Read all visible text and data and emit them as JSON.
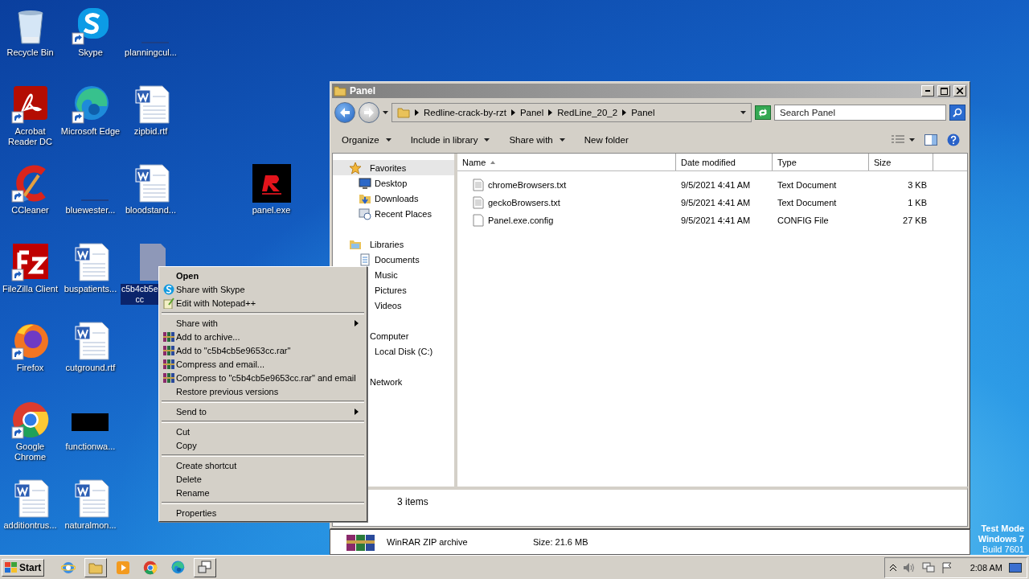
{
  "desktop": {
    "columns": [
      [
        {
          "label": "Recycle Bin",
          "kind": "recycle",
          "shortcut": false,
          "selected": false
        },
        {
          "label": "Acrobat\nReader DC",
          "kind": "acrobat",
          "shortcut": true,
          "selected": false
        },
        {
          "label": "CCleaner",
          "kind": "ccleaner",
          "shortcut": true,
          "selected": false
        },
        {
          "label": "FileZilla Client",
          "kind": "filezilla",
          "shortcut": true,
          "selected": false
        },
        {
          "label": "Firefox",
          "kind": "firefox",
          "shortcut": true,
          "selected": false
        },
        {
          "label": "Google\nChrome",
          "kind": "chrome",
          "shortcut": true,
          "selected": false
        },
        {
          "label": "additiontrus...",
          "kind": "word",
          "shortcut": false,
          "selected": false
        }
      ],
      [
        {
          "label": "Skype",
          "kind": "skype",
          "shortcut": true,
          "selected": false
        },
        {
          "label": "Microsoft Edge",
          "kind": "edge",
          "shortcut": true,
          "selected": false
        },
        {
          "label": "bluewester...",
          "kind": "blank",
          "shortcut": false,
          "selected": false
        },
        {
          "label": "buspatients...",
          "kind": "word",
          "shortcut": false,
          "selected": false
        },
        {
          "label": "cutground.rtf",
          "kind": "word",
          "shortcut": false,
          "selected": false
        },
        {
          "label": "functionwa...",
          "kind": "black",
          "shortcut": false,
          "selected": false
        },
        {
          "label": "naturalmon...",
          "kind": "word",
          "shortcut": false,
          "selected": false
        }
      ],
      [
        {
          "label": "planningcul...",
          "kind": "blank",
          "shortcut": false,
          "selected": false
        },
        {
          "label": "zipbid.rtf",
          "kind": "word",
          "shortcut": false,
          "selected": false
        },
        {
          "label": "bloodstand...",
          "kind": "word",
          "shortcut": false,
          "selected": false
        },
        {
          "label": "c5b4cb5e\ncc",
          "kind": "generic",
          "shortcut": false,
          "selected": true
        }
      ]
    ],
    "free_icon": {
      "label": "panel.exe",
      "kind": "redline",
      "selected": false
    }
  },
  "context_menu": [
    {
      "kind": "plain",
      "label": "Open",
      "default": true
    },
    {
      "kind": "skype",
      "label": "Share with Skype",
      "default": false
    },
    {
      "kind": "notepad",
      "label": "Edit with Notepad++",
      "default": false
    },
    {
      "kind": "separator"
    },
    {
      "kind": "submenu",
      "label": "Share with",
      "default": false
    },
    {
      "kind": "archive",
      "label": "Add to archive...",
      "default": false
    },
    {
      "kind": "archive",
      "label": "Add to \"c5b4cb5e9653cc.rar\"",
      "default": false
    },
    {
      "kind": "archive",
      "label": "Compress and email...",
      "default": false
    },
    {
      "kind": "archive",
      "label": "Compress to \"c5b4cb5e9653cc.rar\" and email",
      "default": false
    },
    {
      "kind": "plain",
      "label": "Restore previous versions",
      "default": false
    },
    {
      "kind": "separator"
    },
    {
      "kind": "submenu",
      "label": "Send to",
      "default": false
    },
    {
      "kind": "separator"
    },
    {
      "kind": "plain",
      "label": "Cut",
      "default": false
    },
    {
      "kind": "plain",
      "label": "Copy",
      "default": false
    },
    {
      "kind": "separator"
    },
    {
      "kind": "plain",
      "label": "Create shortcut",
      "default": false
    },
    {
      "kind": "plain",
      "label": "Delete",
      "default": false
    },
    {
      "kind": "plain",
      "label": "Rename",
      "default": false
    },
    {
      "kind": "separator"
    },
    {
      "kind": "plain",
      "label": "Properties",
      "default": false
    }
  ],
  "explorer": {
    "title": "Panel",
    "breadcrumb": [
      "Redline-crack-by-rzt",
      "Panel",
      "RedLine_20_2",
      "Panel"
    ],
    "search": {
      "placeholder": "Search Panel"
    },
    "toolbar": [
      {
        "label": "Organize",
        "dropdown": true
      },
      {
        "label": "Include in library",
        "dropdown": true
      },
      {
        "label": "Share with",
        "dropdown": true
      },
      {
        "label": "New folder",
        "dropdown": false
      }
    ],
    "nav": [
      {
        "label": "Favorites",
        "kind": "star",
        "selected": true,
        "children": [
          {
            "label": "Desktop",
            "kind": "desktop",
            "selected": false
          },
          {
            "label": "Downloads",
            "kind": "downloads",
            "selected": false
          },
          {
            "label": "Recent Places",
            "kind": "recent",
            "selected": false
          }
        ]
      },
      {
        "label": "Libraries",
        "kind": "library",
        "selected": false,
        "children": [
          {
            "label": "Documents",
            "kind": "documents",
            "selected": false
          },
          {
            "label": "Music",
            "kind": "plain",
            "selected": false
          },
          {
            "label": "Pictures",
            "kind": "plain",
            "selected": false
          },
          {
            "label": "Videos",
            "kind": "plain",
            "selected": false
          }
        ]
      },
      {
        "label": "Computer",
        "kind": "plain",
        "selected": false,
        "children": [
          {
            "label": "Local Disk (C:)",
            "kind": "plain",
            "selected": false
          }
        ]
      },
      {
        "label": "Network",
        "kind": "plain",
        "selected": false
      }
    ],
    "columns": [
      {
        "label": "Name",
        "sorted": true
      },
      {
        "label": "Date modified",
        "sorted": false
      },
      {
        "label": "Type",
        "sorted": false
      },
      {
        "label": "Size",
        "sorted": false
      }
    ],
    "rows": [
      {
        "name": "chromeBrowsers.txt",
        "kind": "text",
        "date": "9/5/2021 4:41 AM",
        "type": "Text Document",
        "size": "3 KB"
      },
      {
        "name": "geckoBrowsers.txt",
        "kind": "text",
        "date": "9/5/2021 4:41 AM",
        "type": "Text Document",
        "size": "1 KB"
      },
      {
        "name": "Panel.exe.config",
        "kind": "config",
        "date": "9/5/2021 4:41 AM",
        "type": "CONFIG File",
        "size": "27 KB"
      }
    ],
    "status": "3 items"
  },
  "background_window": {
    "file_type": "WinRAR ZIP archive",
    "size": "Size: 21.6 MB"
  },
  "test_mode": [
    "Test Mode",
    "Windows 7",
    "Build 7601"
  ],
  "taskbar": {
    "start": "Start",
    "apps": [
      {
        "kind": "ie",
        "selected": false
      },
      {
        "kind": "folder",
        "selected": true
      },
      {
        "kind": "media",
        "selected": false
      },
      {
        "kind": "chrome",
        "selected": false
      },
      {
        "kind": "edge",
        "selected": false
      },
      {
        "kind": "network",
        "selected": true
      }
    ],
    "clock": "2:08 AM"
  }
}
